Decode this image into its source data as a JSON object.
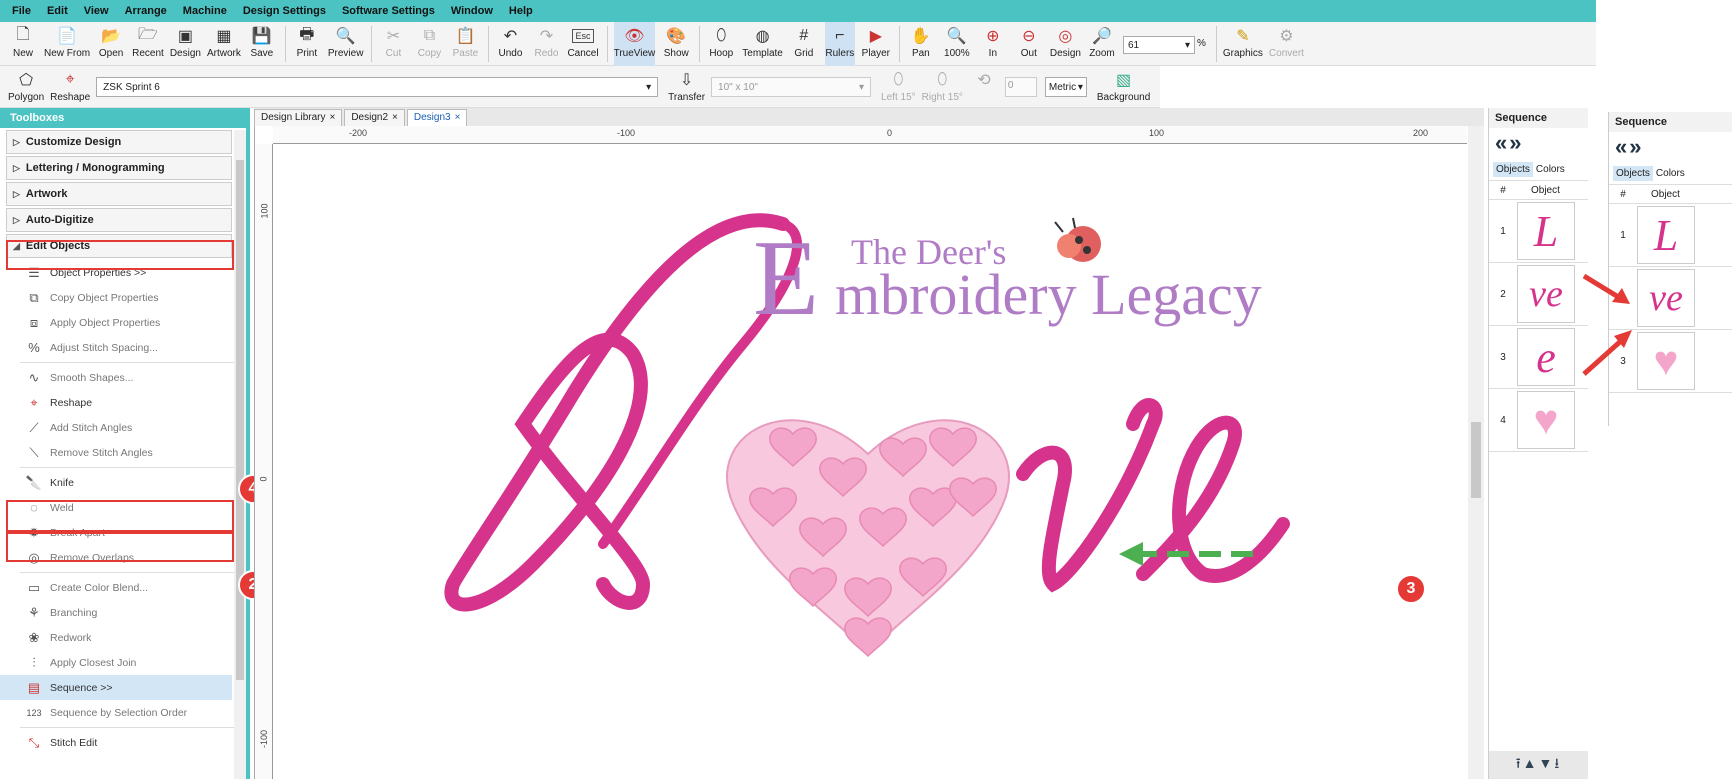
{
  "menu": [
    "File",
    "Edit",
    "View",
    "Arrange",
    "Machine",
    "Design Settings",
    "Software Settings",
    "Window",
    "Help"
  ],
  "toolbar1": {
    "buttons": [
      {
        "label": "New",
        "icon": "new-file-icon"
      },
      {
        "label": "New From",
        "icon": "new-from-icon"
      },
      {
        "label": "Open",
        "icon": "open-folder-icon"
      },
      {
        "label": "Recent",
        "icon": "recent-folder-icon"
      },
      {
        "label": "Design",
        "icon": "design-icon"
      },
      {
        "label": "Artwork",
        "icon": "artwork-icon"
      },
      {
        "label": "Save",
        "icon": "save-icon"
      },
      {
        "label": "Print",
        "icon": "print-icon"
      },
      {
        "label": "Preview",
        "icon": "preview-icon"
      },
      {
        "label": "Cut",
        "icon": "cut-icon"
      },
      {
        "label": "Copy",
        "icon": "copy-icon"
      },
      {
        "label": "Paste",
        "icon": "paste-icon"
      },
      {
        "label": "Undo",
        "icon": "undo-icon"
      },
      {
        "label": "Redo",
        "icon": "redo-icon"
      },
      {
        "label": "Cancel",
        "icon": "escape-icon",
        "glyph": "Esc"
      },
      {
        "label": "TrueView",
        "icon": "trueview-icon"
      },
      {
        "label": "Show",
        "icon": "show-icon"
      },
      {
        "label": "Hoop",
        "icon": "hoop-icon"
      },
      {
        "label": "Template",
        "icon": "template-icon"
      },
      {
        "label": "Grid",
        "icon": "grid-icon"
      },
      {
        "label": "Rulers",
        "icon": "rulers-icon"
      },
      {
        "label": "Player",
        "icon": "player-icon"
      },
      {
        "label": "Pan",
        "icon": "pan-hand-icon"
      },
      {
        "label": "100%",
        "icon": "zoom-100-icon"
      },
      {
        "label": "In",
        "icon": "zoom-in-icon"
      },
      {
        "label": "Out",
        "icon": "zoom-out-icon"
      },
      {
        "label": "Design",
        "icon": "zoom-design-icon"
      },
      {
        "label": "Zoom",
        "icon": "zoom-icon"
      }
    ],
    "zoom_value": "61",
    "zoom_unit": "%",
    "graphics_label": "Graphics",
    "convert_label": "Convert"
  },
  "toolbar2": {
    "polygon_label": "Polygon",
    "reshape_label": "Reshape",
    "machine": "ZSK Sprint 6",
    "transfer_label": "Transfer",
    "hoop": "10\" x 10\"",
    "left_label": "Left 15°",
    "right_label": "Right 15°",
    "angle_value": "0",
    "units": "Metric",
    "background_label": "Background"
  },
  "toolboxes": {
    "title": "Toolboxes",
    "sections": [
      "Customize Design",
      "Lettering / Monogramming",
      "Artwork",
      "Auto-Digitize",
      "Edit Objects"
    ],
    "tools": [
      {
        "label": "Object Properties >>",
        "icon": "object-properties-icon",
        "dim": false
      },
      {
        "label": "Copy Object Properties",
        "icon": "copy-properties-icon",
        "dim": true
      },
      {
        "label": "Apply Object Properties",
        "icon": "apply-properties-icon",
        "dim": true
      },
      {
        "label": "Adjust Stitch Spacing...",
        "icon": "stitch-spacing-icon",
        "dim": true
      },
      {
        "label": "Smooth Shapes...",
        "icon": "smooth-shapes-icon",
        "dim": true
      },
      {
        "label": "Reshape",
        "icon": "reshape-icon",
        "dim": false
      },
      {
        "label": "Add Stitch Angles",
        "icon": "add-angles-icon",
        "dim": true
      },
      {
        "label": "Remove Stitch Angles",
        "icon": "remove-angles-icon",
        "dim": true
      },
      {
        "label": "Knife",
        "icon": "knife-icon",
        "dim": false
      },
      {
        "label": "Weld",
        "icon": "weld-icon",
        "dim": true
      },
      {
        "label": "Break Apart",
        "icon": "break-apart-icon",
        "dim": true
      },
      {
        "label": "Remove Overlaps",
        "icon": "remove-overlaps-icon",
        "dim": true
      },
      {
        "label": "Create Color Blend...",
        "icon": "color-blend-icon",
        "dim": true
      },
      {
        "label": "Branching",
        "icon": "branching-icon",
        "dim": true
      },
      {
        "label": "Redwork",
        "icon": "redwork-icon",
        "dim": true
      },
      {
        "label": "Apply Closest Join",
        "icon": "closest-join-icon",
        "dim": true
      },
      {
        "label": "Sequence >>",
        "icon": "sequence-icon",
        "dim": false,
        "selected": true
      },
      {
        "label": "Sequence by Selection Order",
        "icon": "sequence-order-icon",
        "dim": true
      },
      {
        "label": "Stitch Edit",
        "icon": "stitch-edit-icon",
        "dim": false
      }
    ]
  },
  "badges": {
    "b4": "4",
    "b2": "2",
    "b3": "3"
  },
  "design_tabs": [
    {
      "label": "Design Library",
      "active": false
    },
    {
      "label": "Design2",
      "active": false
    },
    {
      "label": "Design3",
      "active": true
    }
  ],
  "rulers": {
    "h": [
      "-200",
      "-100",
      "0",
      "100",
      "200"
    ],
    "v": [
      "100",
      "0",
      "-100"
    ]
  },
  "artwork": {
    "logo_line1": "The Deer's",
    "logo_line2": "mbroidery Legacy",
    "logo_initial": "E"
  },
  "sequence_panel": {
    "title": "Sequence",
    "nav_prev": "«",
    "nav_next": "»",
    "tab_objects": "Objects",
    "tab_colors": "Colors",
    "col_num": "#",
    "col_object": "Object",
    "rows": [
      {
        "num": "1",
        "glyph": "L"
      },
      {
        "num": "2",
        "glyph": "ve"
      },
      {
        "num": "3",
        "glyph": "e"
      },
      {
        "num": "4",
        "glyph": "heart"
      }
    ],
    "bottom_controls": "⭱▲▼⭳"
  },
  "sequence_panel2": {
    "title": "Sequence",
    "rows": [
      {
        "num": "1",
        "glyph": "L"
      },
      {
        "num": "2",
        "glyph": "ve"
      },
      {
        "num": "3",
        "glyph": "heart"
      }
    ]
  },
  "colors": {
    "teal": "#4cc3c3",
    "pink": "#d6338c",
    "lightpink": "#f3b6d2",
    "purple": "#b07cc6",
    "red": "#e53935",
    "green": "#4caf50"
  }
}
